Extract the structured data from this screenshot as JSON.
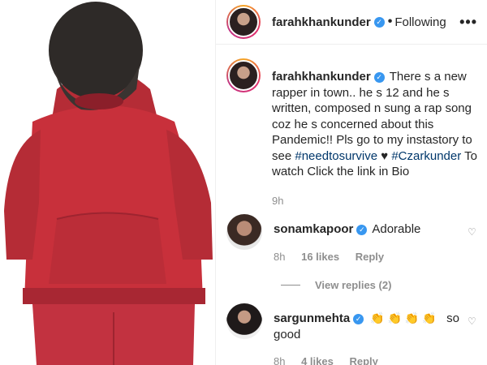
{
  "post": {
    "username": "farahkhankunder",
    "following_label": "Following",
    "more_label": "•••"
  },
  "caption": {
    "username": "farahkhankunder",
    "text_before": "There s a new rapper in town.. he s 12 and he s written, composed n sung a rap song coz he s concerned about this Pandemic!! Pls go to my instastory to see ",
    "hashtag1": "#needtosurvive",
    "text_middle": " ♥ ",
    "hashtag2": "#Czarkunder",
    "text_after": " To watch Click the link in Bio",
    "time": "9h"
  },
  "comments": [
    {
      "username": "sonamkapoor",
      "text": "Adorable",
      "time": "8h",
      "likes": "16 likes",
      "reply_label": "Reply",
      "view_replies": "View replies (2)"
    },
    {
      "username": "sargunmehta",
      "claps": "👏 👏 👏 👏",
      "text": "so good",
      "time": "8h",
      "likes": "4 likes",
      "reply_label": "Reply"
    }
  ],
  "colors": {
    "hoodie": "#c8303b",
    "hair": "#2e2a28",
    "link": "#00376b",
    "verified": "#3897f0"
  }
}
